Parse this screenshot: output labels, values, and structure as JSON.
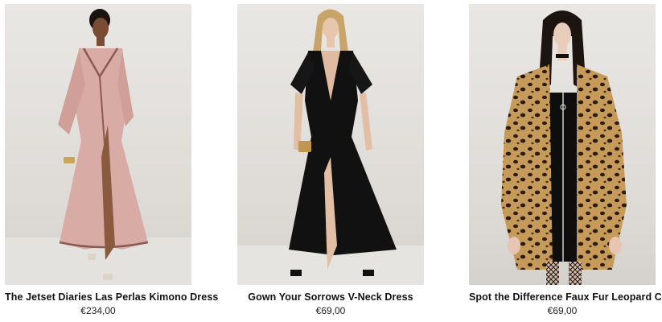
{
  "products": [
    {
      "name": "The Jetset Diaries Las Perlas Kimono Dress",
      "price": "€234,00",
      "image": "woman-pink-kimono-dress"
    },
    {
      "name": "Gown Your Sorrows V-Neck Dress",
      "price": "€69,00",
      "image": "woman-black-v-neck-dress"
    },
    {
      "name": "Spot the Difference Faux Fur Leopard Coat",
      "price": "€69,00",
      "image": "woman-leopard-fur-coat"
    }
  ],
  "colors": {
    "pink_dress": "#d8aba4",
    "black_dress": "#111111",
    "leopard": "#c69a58"
  }
}
